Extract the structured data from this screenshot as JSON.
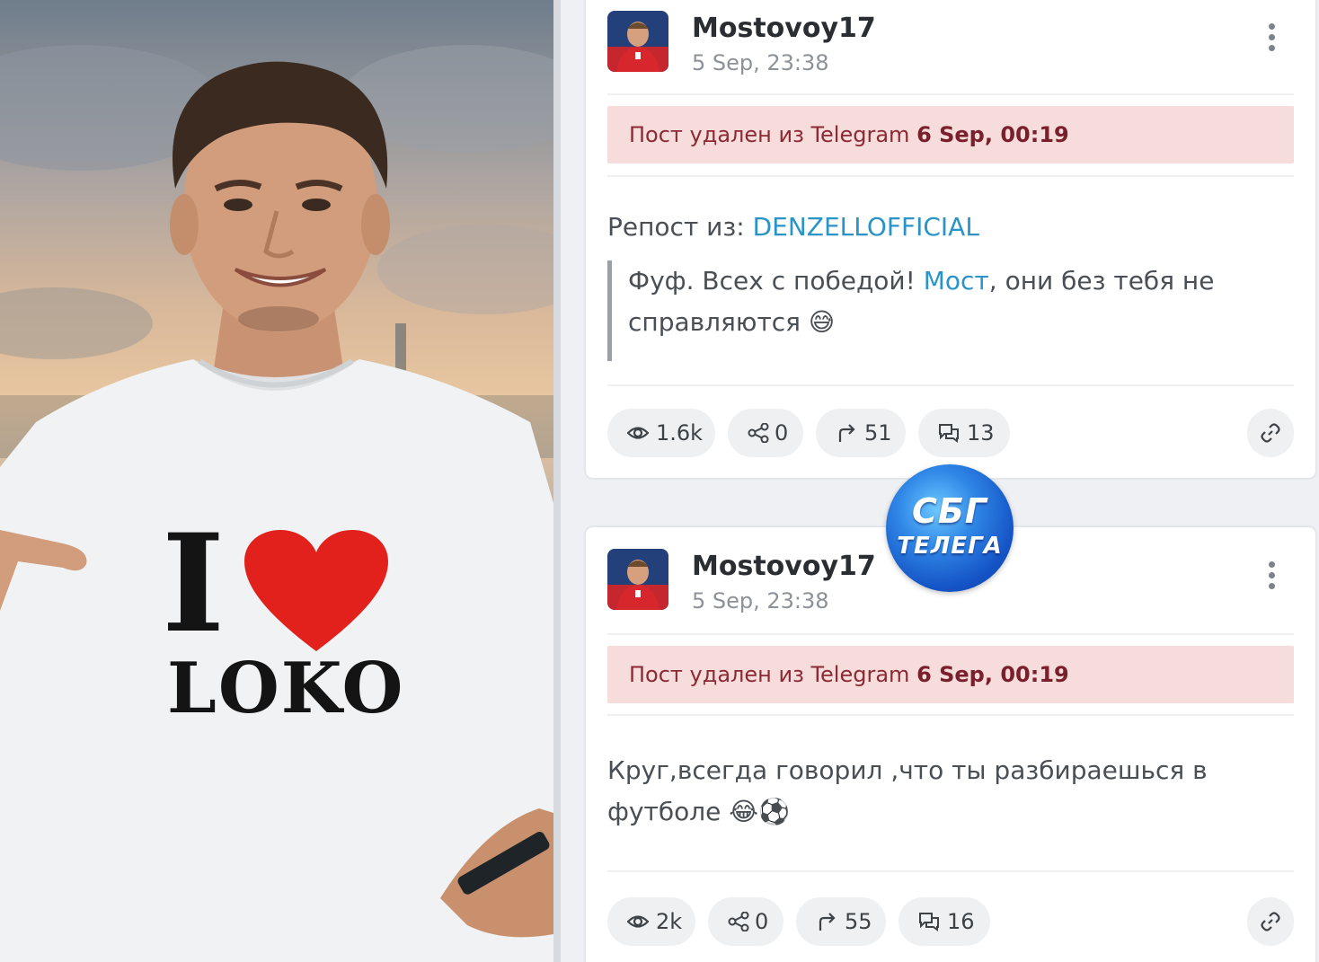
{
  "posts": [
    {
      "author": "Mostovoy17",
      "date": "5 Sep, 23:38",
      "deleted_prefix": "Пост удален из Telegram",
      "deleted_date": "6 Sep, 00:19",
      "repost_label": "Репост из:",
      "repost_source": "DENZELLOFFICIAL",
      "quote_part1": "Фуф. Всех с победой!",
      "quote_mention": "Мост",
      "quote_part2": ", они без тебя не справляются 😅",
      "stats": {
        "views": "1.6k",
        "shares": "0",
        "forwards": "51",
        "comments": "13"
      }
    },
    {
      "author": "Mostovoy17",
      "date": "5 Sep, 23:38",
      "deleted_prefix": "Пост удален из Telegram",
      "deleted_date": "6 Sep, 00:19",
      "text": "Круг,всегда говорил ,что ты разбираешься в футболе 😂⚽",
      "stats": {
        "views": "2k",
        "shares": "0",
        "forwards": "55",
        "comments": "16"
      }
    }
  ],
  "photo": {
    "shirt_text_i": "I",
    "shirt_text_loko": "LOKO"
  },
  "badge": {
    "line1": "СБГ",
    "line2": "ТЕЛЕГА"
  },
  "icons": {
    "views": "eye-icon",
    "shares": "share-icon",
    "forwards": "forward-icon",
    "comments": "comments-icon",
    "link": "link-icon",
    "menu": "more-vertical-icon"
  },
  "colors": {
    "deleted_bg": "#f7dcdc",
    "deleted_text": "#8b2a34",
    "link_blue": "#2a93c8",
    "badge_blue": "#1554c6"
  }
}
